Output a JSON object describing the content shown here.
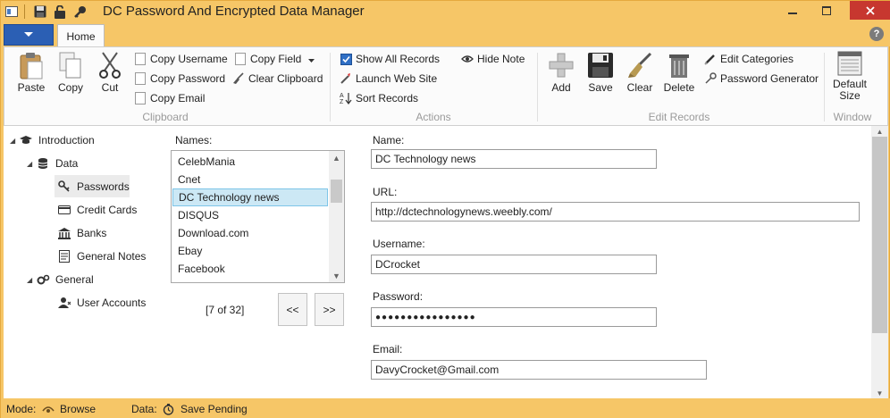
{
  "window": {
    "title": "DC Password And Encrypted Data Manager",
    "accent": "#f6c667",
    "close_color": "#c7372f"
  },
  "quick_access": {
    "icons": [
      "app-icon",
      "save-icon",
      "unlock-icon",
      "key-icon"
    ]
  },
  "ribbon": {
    "tabs": [
      {
        "label": "Home"
      }
    ],
    "help_label": "?",
    "groups": {
      "clipboard": {
        "label": "Clipboard",
        "paste": "Paste",
        "copy": "Copy",
        "cut": "Cut",
        "copy_username": "Copy Username",
        "copy_password": "Copy Password",
        "copy_email": "Copy Email",
        "copy_field": "Copy Field",
        "clear_clipboard": "Clear Clipboard"
      },
      "actions": {
        "label": "Actions",
        "show_all_records": "Show All Records",
        "hide_note": "Hide Note",
        "launch_web_site": "Launch Web Site",
        "sort_records": "Sort Records",
        "show_all_checked": true
      },
      "edit_records": {
        "label": "Edit Records",
        "add": "Add",
        "save": "Save",
        "clear": "Clear",
        "delete": "Delete",
        "edit_categories": "Edit Categories",
        "password_generator": "Password Generator"
      },
      "window": {
        "label": "Window",
        "default_size": "Default Size"
      }
    }
  },
  "tree": {
    "items": [
      {
        "label": "Introduction",
        "icon": "graduation-cap-icon"
      },
      {
        "label": "Data",
        "icon": "database-icon"
      },
      {
        "label": "Passwords",
        "icon": "key-icon"
      },
      {
        "label": "Credit Cards",
        "icon": "credit-card-icon"
      },
      {
        "label": "Banks",
        "icon": "bank-icon"
      },
      {
        "label": "General Notes",
        "icon": "note-icon"
      },
      {
        "label": "General",
        "icon": "gears-icon"
      },
      {
        "label": "User Accounts",
        "icon": "user-icon"
      }
    ],
    "selected": "Passwords"
  },
  "names": {
    "label": "Names:",
    "items": [
      "CelebMania",
      "Cnet",
      "DC Technology news",
      "DISQUS",
      "Download.com",
      "Ebay",
      "Facebook"
    ],
    "selected_index": 2,
    "counter": "[7 of 32]",
    "prev_label": "<<",
    "next_label": ">>"
  },
  "record": {
    "name_label": "Name:",
    "name_value": "DC Technology news",
    "url_label": "URL:",
    "url_value": "http://dctechnologynews.weebly.com/",
    "username_label": "Username:",
    "username_value": "DCrocket",
    "password_label": "Password:",
    "password_value": "●●●●●●●●●●●●●●●●",
    "email_label": "Email:",
    "email_value": "DavyCrocket@Gmail.com"
  },
  "status": {
    "mode_label": "Mode:",
    "mode_value": "Browse",
    "data_label": "Data:",
    "data_value": "Save Pending"
  }
}
